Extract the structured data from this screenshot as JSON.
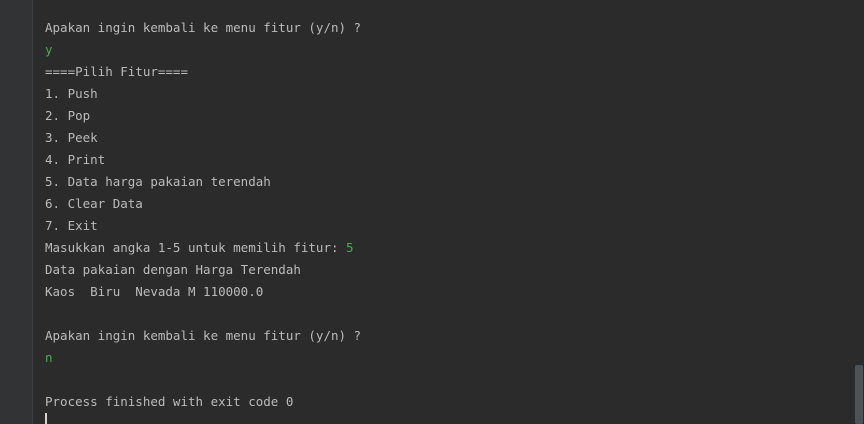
{
  "console": {
    "prompt_back_1": "Apakan ingin kembali ke menu fitur (y/n) ?",
    "input_y": "y",
    "menu_header": "====Pilih Fitur====",
    "menu_items": [
      "1. Push",
      "2. Pop",
      "3. Peek",
      "4. Print",
      "5. Data harga pakaian terendah",
      "6. Clear Data",
      "7. Exit"
    ],
    "choose_prompt": "Masukkan angka 1-5 untuk memilih fitur: ",
    "choose_input": "5",
    "result_header": "Data pakaian dengan Harga Terendah",
    "result_row": "Kaos  Biru  Nevada M 110000.0",
    "prompt_back_2": "Apakan ingin kembali ke menu fitur (y/n) ?",
    "input_n": "n",
    "exit_message": "Process finished with exit code 0"
  },
  "colors": {
    "background": "#2b2b2b",
    "text": "#bbbbbb",
    "user_input": "#4fa84f"
  }
}
